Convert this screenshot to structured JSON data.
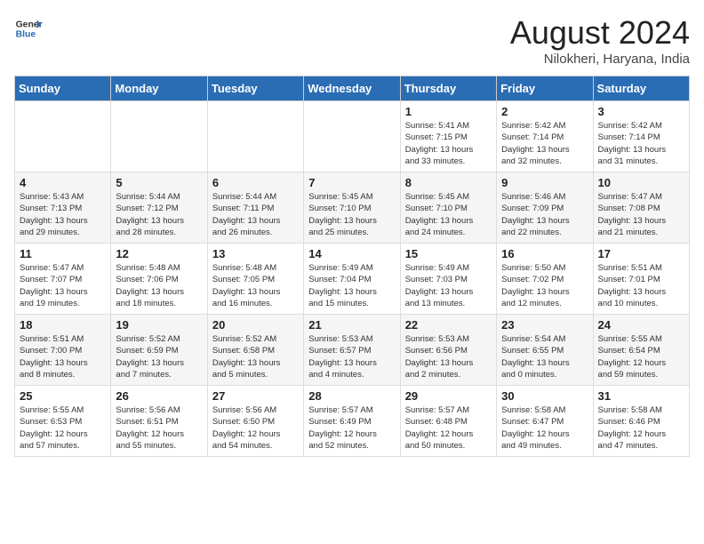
{
  "logo": {
    "line1": "General",
    "line2": "Blue"
  },
  "title": "August 2024",
  "subtitle": "Nilokheri, Haryana, India",
  "weekdays": [
    "Sunday",
    "Monday",
    "Tuesday",
    "Wednesday",
    "Thursday",
    "Friday",
    "Saturday"
  ],
  "weeks": [
    [
      {
        "day": "",
        "info": ""
      },
      {
        "day": "",
        "info": ""
      },
      {
        "day": "",
        "info": ""
      },
      {
        "day": "",
        "info": ""
      },
      {
        "day": "1",
        "info": "Sunrise: 5:41 AM\nSunset: 7:15 PM\nDaylight: 13 hours\nand 33 minutes."
      },
      {
        "day": "2",
        "info": "Sunrise: 5:42 AM\nSunset: 7:14 PM\nDaylight: 13 hours\nand 32 minutes."
      },
      {
        "day": "3",
        "info": "Sunrise: 5:42 AM\nSunset: 7:14 PM\nDaylight: 13 hours\nand 31 minutes."
      }
    ],
    [
      {
        "day": "4",
        "info": "Sunrise: 5:43 AM\nSunset: 7:13 PM\nDaylight: 13 hours\nand 29 minutes."
      },
      {
        "day": "5",
        "info": "Sunrise: 5:44 AM\nSunset: 7:12 PM\nDaylight: 13 hours\nand 28 minutes."
      },
      {
        "day": "6",
        "info": "Sunrise: 5:44 AM\nSunset: 7:11 PM\nDaylight: 13 hours\nand 26 minutes."
      },
      {
        "day": "7",
        "info": "Sunrise: 5:45 AM\nSunset: 7:10 PM\nDaylight: 13 hours\nand 25 minutes."
      },
      {
        "day": "8",
        "info": "Sunrise: 5:45 AM\nSunset: 7:10 PM\nDaylight: 13 hours\nand 24 minutes."
      },
      {
        "day": "9",
        "info": "Sunrise: 5:46 AM\nSunset: 7:09 PM\nDaylight: 13 hours\nand 22 minutes."
      },
      {
        "day": "10",
        "info": "Sunrise: 5:47 AM\nSunset: 7:08 PM\nDaylight: 13 hours\nand 21 minutes."
      }
    ],
    [
      {
        "day": "11",
        "info": "Sunrise: 5:47 AM\nSunset: 7:07 PM\nDaylight: 13 hours\nand 19 minutes."
      },
      {
        "day": "12",
        "info": "Sunrise: 5:48 AM\nSunset: 7:06 PM\nDaylight: 13 hours\nand 18 minutes."
      },
      {
        "day": "13",
        "info": "Sunrise: 5:48 AM\nSunset: 7:05 PM\nDaylight: 13 hours\nand 16 minutes."
      },
      {
        "day": "14",
        "info": "Sunrise: 5:49 AM\nSunset: 7:04 PM\nDaylight: 13 hours\nand 15 minutes."
      },
      {
        "day": "15",
        "info": "Sunrise: 5:49 AM\nSunset: 7:03 PM\nDaylight: 13 hours\nand 13 minutes."
      },
      {
        "day": "16",
        "info": "Sunrise: 5:50 AM\nSunset: 7:02 PM\nDaylight: 13 hours\nand 12 minutes."
      },
      {
        "day": "17",
        "info": "Sunrise: 5:51 AM\nSunset: 7:01 PM\nDaylight: 13 hours\nand 10 minutes."
      }
    ],
    [
      {
        "day": "18",
        "info": "Sunrise: 5:51 AM\nSunset: 7:00 PM\nDaylight: 13 hours\nand 8 minutes."
      },
      {
        "day": "19",
        "info": "Sunrise: 5:52 AM\nSunset: 6:59 PM\nDaylight: 13 hours\nand 7 minutes."
      },
      {
        "day": "20",
        "info": "Sunrise: 5:52 AM\nSunset: 6:58 PM\nDaylight: 13 hours\nand 5 minutes."
      },
      {
        "day": "21",
        "info": "Sunrise: 5:53 AM\nSunset: 6:57 PM\nDaylight: 13 hours\nand 4 minutes."
      },
      {
        "day": "22",
        "info": "Sunrise: 5:53 AM\nSunset: 6:56 PM\nDaylight: 13 hours\nand 2 minutes."
      },
      {
        "day": "23",
        "info": "Sunrise: 5:54 AM\nSunset: 6:55 PM\nDaylight: 13 hours\nand 0 minutes."
      },
      {
        "day": "24",
        "info": "Sunrise: 5:55 AM\nSunset: 6:54 PM\nDaylight: 12 hours\nand 59 minutes."
      }
    ],
    [
      {
        "day": "25",
        "info": "Sunrise: 5:55 AM\nSunset: 6:53 PM\nDaylight: 12 hours\nand 57 minutes."
      },
      {
        "day": "26",
        "info": "Sunrise: 5:56 AM\nSunset: 6:51 PM\nDaylight: 12 hours\nand 55 minutes."
      },
      {
        "day": "27",
        "info": "Sunrise: 5:56 AM\nSunset: 6:50 PM\nDaylight: 12 hours\nand 54 minutes."
      },
      {
        "day": "28",
        "info": "Sunrise: 5:57 AM\nSunset: 6:49 PM\nDaylight: 12 hours\nand 52 minutes."
      },
      {
        "day": "29",
        "info": "Sunrise: 5:57 AM\nSunset: 6:48 PM\nDaylight: 12 hours\nand 50 minutes."
      },
      {
        "day": "30",
        "info": "Sunrise: 5:58 AM\nSunset: 6:47 PM\nDaylight: 12 hours\nand 49 minutes."
      },
      {
        "day": "31",
        "info": "Sunrise: 5:58 AM\nSunset: 6:46 PM\nDaylight: 12 hours\nand 47 minutes."
      }
    ]
  ]
}
